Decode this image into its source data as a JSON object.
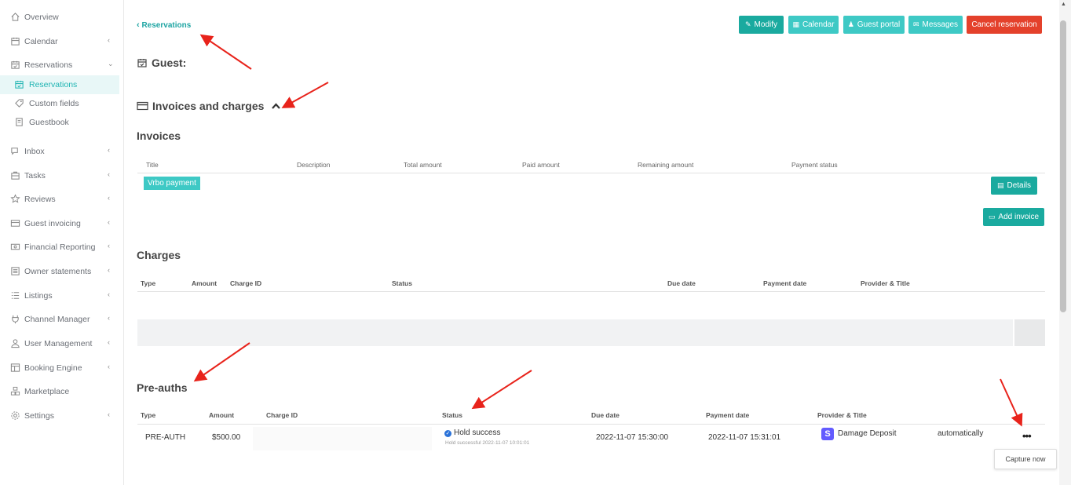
{
  "sidebar": {
    "items": [
      {
        "label": "Overview",
        "icon": "home-icon",
        "chevron": ""
      },
      {
        "label": "Calendar",
        "icon": "calendar-icon",
        "chevron": "‹"
      },
      {
        "label": "Reservations",
        "icon": "calendar-check-icon",
        "chevron": "⌄"
      },
      {
        "label": "Reservations",
        "icon": "calendar-check-icon",
        "chevron": "",
        "sub": true,
        "active": true
      },
      {
        "label": "Custom fields",
        "icon": "tag-icon",
        "chevron": "",
        "sub": true
      },
      {
        "label": "Guestbook",
        "icon": "book-icon",
        "chevron": "",
        "sub": true
      },
      {
        "label": "Inbox",
        "icon": "chat-icon",
        "chevron": "‹"
      },
      {
        "label": "Tasks",
        "icon": "briefcase-icon",
        "chevron": "‹"
      },
      {
        "label": "Reviews",
        "icon": "star-icon",
        "chevron": "‹"
      },
      {
        "label": "Guest invoicing",
        "icon": "card-icon",
        "chevron": "‹"
      },
      {
        "label": "Financial Reporting",
        "icon": "money-icon",
        "chevron": "‹"
      },
      {
        "label": "Owner statements",
        "icon": "list-icon",
        "chevron": "‹"
      },
      {
        "label": "Listings",
        "icon": "listings-icon",
        "chevron": "‹"
      },
      {
        "label": "Channel Manager",
        "icon": "plug-icon",
        "chevron": "‹"
      },
      {
        "label": "User Management",
        "icon": "user-icon",
        "chevron": "‹"
      },
      {
        "label": "Booking Engine",
        "icon": "layout-icon",
        "chevron": "‹"
      },
      {
        "label": "Marketplace",
        "icon": "grid-icon",
        "chevron": ""
      },
      {
        "label": "Settings",
        "icon": "gear-icon",
        "chevron": "‹"
      }
    ]
  },
  "header": {
    "back_label": "Reservations",
    "buttons": {
      "modify": "Modify",
      "calendar": "Calendar",
      "guest_portal": "Guest portal",
      "messages": "Messages",
      "cancel": "Cancel reservation"
    }
  },
  "guest": {
    "title": "Guest:"
  },
  "invoices_charges": {
    "title": "Invoices and charges"
  },
  "invoices": {
    "title": "Invoices",
    "columns": [
      "Title",
      "Description",
      "Total amount",
      "Paid amount",
      "Remaining amount",
      "Payment status"
    ],
    "rows": [
      {
        "title": "Vrbo payment"
      }
    ],
    "details_label": "Details",
    "add_invoice_label": "Add invoice"
  },
  "charges": {
    "title": "Charges",
    "columns": [
      "Type",
      "Amount",
      "Charge ID",
      "Status",
      "Due date",
      "Payment date",
      "Provider & Title"
    ]
  },
  "preauths": {
    "title": "Pre-auths",
    "columns": [
      "Type",
      "Amount",
      "Charge ID",
      "Status",
      "Due date",
      "Payment date",
      "Provider & Title"
    ],
    "row": {
      "type": "PRE-AUTH",
      "amount": "$500.00",
      "status": "Hold success",
      "status_detail": "Hold successful 2022-11-07 10:01:01",
      "due_date": "2022-11-07 15:30:00",
      "payment_date": "2022-11-07 15:31:01",
      "provider_title": "Damage Deposit",
      "mode": "automatically",
      "menu": "•••"
    },
    "tooltip": "Capture now"
  },
  "colors": {
    "accent": "#21b5b3",
    "danger": "#e4412b",
    "annotation": "#e8231b"
  }
}
